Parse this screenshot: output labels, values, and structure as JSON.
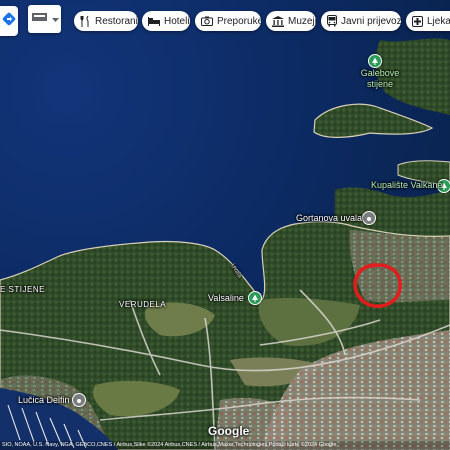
{
  "toolbar": {
    "chips": [
      {
        "label": "Restorani",
        "icon": "fork-knife-icon"
      },
      {
        "label": "Hoteli",
        "icon": "bed-icon"
      },
      {
        "label": "Preporuke",
        "icon": "camera-icon"
      },
      {
        "label": "Muzeji",
        "icon": "museum-icon"
      },
      {
        "label": "Javni prijevoz",
        "icon": "bus-icon"
      },
      {
        "label": "Ljekarne",
        "icon": "pharmacy-icon"
      }
    ]
  },
  "places": {
    "galebove_stijene": "Galebove stijene",
    "kupaliste_valkane": "Kupalište Valkane",
    "gortanova_uvala": "Gortanova uvala",
    "valsaline": "Valsaline",
    "verudela": "VERUDELA",
    "stijene": "E STIJENE",
    "lucica_delfin": "Lučica Delfin",
    "uvala_street": "Uvala"
  },
  "branding": {
    "logo": "Google"
  },
  "attribution": "SIO, NOAA, U.S. Navy, NGA, GEBCO,CNES / Airbus,Slike ©2024 Airbus,CNES / Airbus,Maxar Technologies,Podaci karte ©2024 Google",
  "colors": {
    "sea": "#0d2a5c",
    "land": "#3e5a33",
    "marker": "#e21d1d",
    "green_pin": "#2a9b56"
  }
}
